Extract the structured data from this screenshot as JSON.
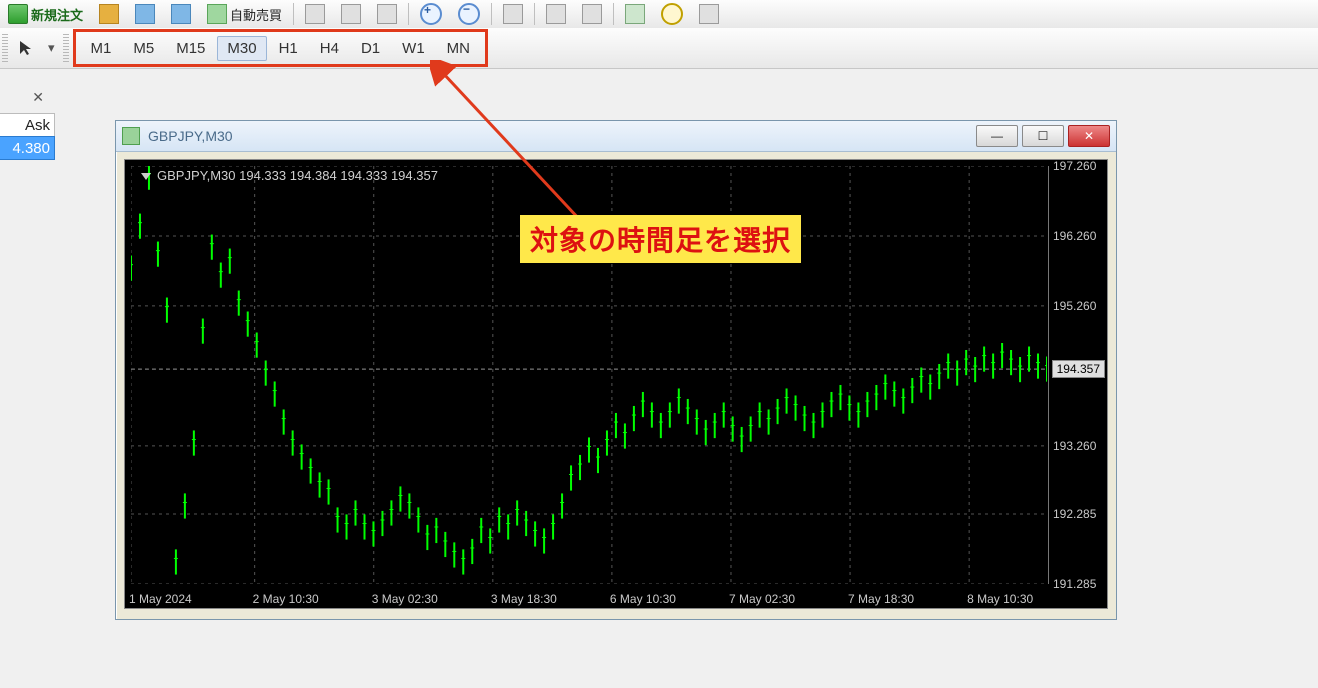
{
  "toolbar": {
    "new_order_label": "新規注文",
    "auto_trade_label": "自動売買"
  },
  "timeframes": {
    "items": [
      "M1",
      "M5",
      "M15",
      "M30",
      "H1",
      "H4",
      "D1",
      "W1",
      "MN"
    ],
    "active": "M30"
  },
  "sidebar": {
    "ask_label": "Ask",
    "ask_value": "4.380"
  },
  "chart_window": {
    "title": "GBPJPY,M30",
    "header_text": "GBPJPY,M30  194.333  194.384  194.333  194.357"
  },
  "annotation": {
    "text": "対象の時間足を選択"
  },
  "chart_data": {
    "type": "line",
    "title": "GBPJPY,M30",
    "ylabel": "",
    "xlabel": "",
    "ylim": [
      191.285,
      197.26
    ],
    "y_ticks": [
      197.26,
      196.26,
      195.26,
      194.357,
      193.26,
      192.285,
      191.285
    ],
    "current_price": 194.357,
    "x_ticks": [
      "1 May 2024",
      "2 May 10:30",
      "3 May 02:30",
      "3 May 18:30",
      "6 May 10:30",
      "7 May 02:30",
      "7 May 18:30",
      "8 May 10:30"
    ],
    "x_tick_pos": [
      0.0,
      0.135,
      0.265,
      0.395,
      0.525,
      0.655,
      0.785,
      0.915
    ],
    "series": [
      {
        "name": "GBPJPY",
        "color": "#00ff00",
        "values": [
          195.8,
          196.4,
          197.1,
          196.0,
          195.2,
          191.6,
          192.4,
          193.3,
          194.9,
          196.1,
          195.7,
          195.9,
          195.3,
          195.0,
          194.7,
          194.3,
          194.0,
          193.6,
          193.3,
          193.1,
          192.9,
          192.7,
          192.6,
          192.2,
          192.1,
          192.3,
          192.1,
          192.0,
          192.15,
          192.3,
          192.5,
          192.4,
          192.2,
          191.95,
          192.05,
          191.85,
          191.7,
          191.6,
          191.75,
          192.05,
          191.9,
          192.2,
          192.1,
          192.3,
          192.15,
          192.0,
          191.9,
          192.1,
          192.4,
          192.8,
          192.95,
          193.2,
          193.05,
          193.3,
          193.55,
          193.4,
          193.65,
          193.85,
          193.7,
          193.55,
          193.7,
          193.9,
          193.75,
          193.6,
          193.45,
          193.55,
          193.7,
          193.5,
          193.35,
          193.5,
          193.7,
          193.6,
          193.75,
          193.9,
          193.8,
          193.65,
          193.55,
          193.7,
          193.85,
          193.95,
          193.8,
          193.7,
          193.85,
          193.95,
          194.1,
          194.0,
          193.9,
          194.05,
          194.2,
          194.1,
          194.25,
          194.4,
          194.3,
          194.45,
          194.35,
          194.5,
          194.4,
          194.55,
          194.45,
          194.35,
          194.5,
          194.4,
          194.357
        ]
      }
    ]
  }
}
